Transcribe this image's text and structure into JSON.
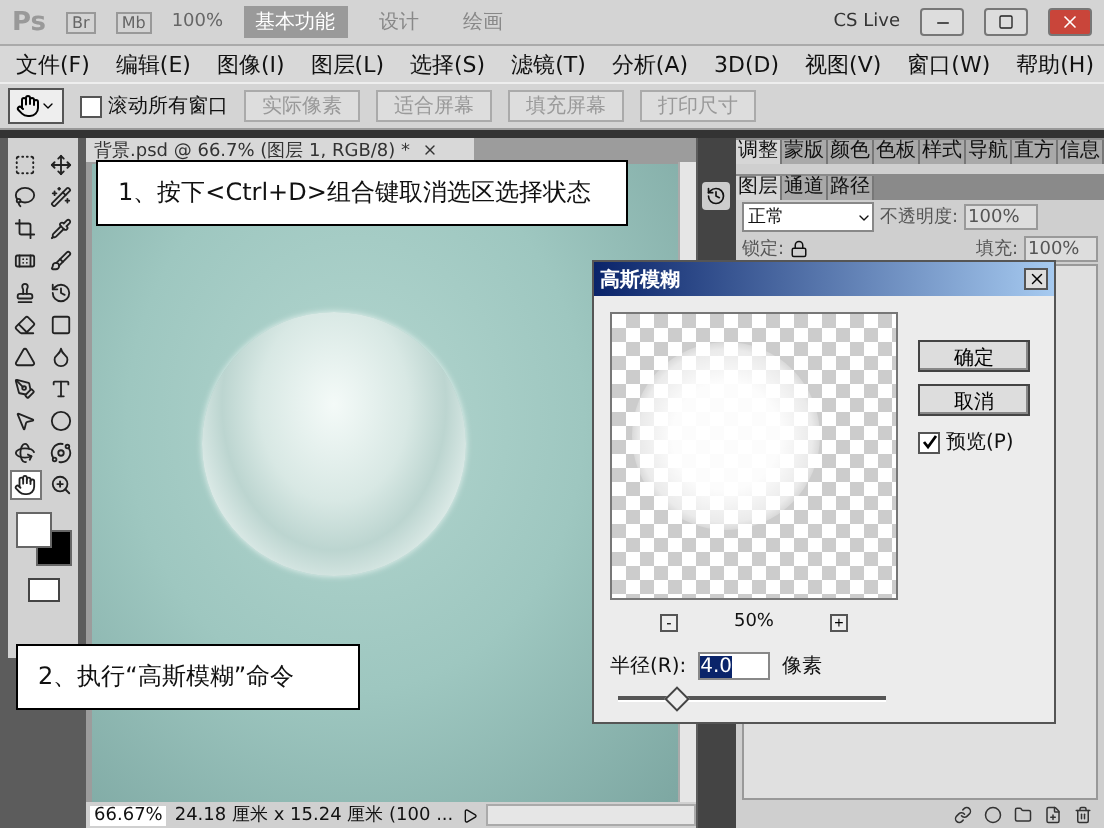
{
  "app_bar": {
    "logo": "Ps",
    "bridge": "Br",
    "mini_bridge": "Mb",
    "zoom": "100%",
    "workspaces": [
      {
        "label": "基本功能",
        "selected": true
      },
      {
        "label": "设计",
        "selected": false
      },
      {
        "label": "绘画",
        "selected": false
      }
    ],
    "cs_live": "CS Live"
  },
  "menu": [
    "文件(F)",
    "编辑(E)",
    "图像(I)",
    "图层(L)",
    "选择(S)",
    "滤镜(T)",
    "分析(A)",
    "3D(D)",
    "视图(V)",
    "窗口(W)",
    "帮助(H)"
  ],
  "options": {
    "scroll_all": {
      "label": "滚动所有窗口",
      "checked": false
    },
    "buttons": [
      "实际像素",
      "适合屏幕",
      "填充屏幕",
      "打印尺寸"
    ]
  },
  "document": {
    "tab": "背景.psd @ 66.7% (图层 1, RGB/8) *"
  },
  "tools": [
    {
      "selected": false
    },
    {
      "selected": false
    },
    {
      "selected": false
    },
    {
      "selected": false
    },
    {
      "selected": false
    },
    {
      "selected": false
    },
    {
      "selected": false
    },
    {
      "selected": false
    },
    {
      "selected": false
    },
    {
      "selected": false
    },
    {
      "selected": false
    },
    {
      "selected": false
    },
    {
      "selected": false
    },
    {
      "selected": false
    },
    {
      "selected": false
    },
    {
      "selected": false
    },
    {
      "selected": false
    },
    {
      "selected": false
    },
    {
      "selected": false
    },
    {
      "selected": false
    },
    {
      "selected": true
    },
    {
      "selected": false
    }
  ],
  "panels": {
    "top_tabs": [
      {
        "label": "调整",
        "selected": true
      },
      {
        "label": "蒙版",
        "selected": false
      },
      {
        "label": "颜色",
        "selected": false
      },
      {
        "label": "色板",
        "selected": false
      },
      {
        "label": "样式",
        "selected": false
      },
      {
        "label": "导航",
        "selected": false
      },
      {
        "label": "直方",
        "selected": false
      },
      {
        "label": "信息",
        "selected": false
      }
    ],
    "layer_tabs": [
      {
        "label": "图层",
        "selected": true
      },
      {
        "label": "通道",
        "selected": false
      },
      {
        "label": "路径",
        "selected": false
      }
    ],
    "blend_mode": "正常",
    "opacity_label": "不透明度:",
    "opacity": "100%",
    "lock_label": "锁定:",
    "fill_label": "填充:",
    "fill": "100%"
  },
  "status": {
    "zoom": "66.67%",
    "doc_size": "24.18 厘米 x 15.24 厘米 (100 ..."
  },
  "notes": [
    "1、按下<Ctrl+D>组合键取消选区选择状态",
    "2、执行“高斯模糊”命令"
  ],
  "dialog": {
    "title": "高斯模糊",
    "ok": "确定",
    "cancel": "取消",
    "preview": {
      "label": "预览(P)",
      "checked": true
    },
    "zoom_out": "-",
    "zoom": "50%",
    "zoom_in": "+",
    "radius_label": "半径(R):",
    "radius": "4.0",
    "unit": "像素",
    "radius_slider": {
      "level": 0.21
    }
  }
}
